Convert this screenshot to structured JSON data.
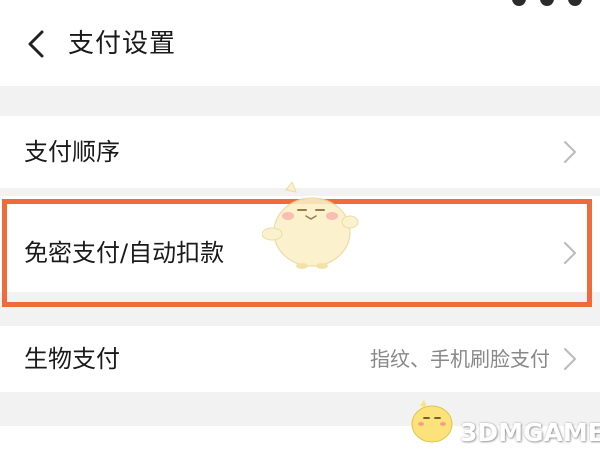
{
  "header": {
    "back_icon": "chevron-left-icon",
    "title": "支付设置"
  },
  "rows": [
    {
      "label": "支付顺序",
      "value": ""
    },
    {
      "label": "免密支付/自动扣款",
      "value": ""
    },
    {
      "label": "生物支付",
      "value": "指纹、手机刷脸支付"
    }
  ],
  "chevron_icon": "chevron-right-icon",
  "highlight_color": "#ee6b3c",
  "watermark": {
    "text": "3DMGAME"
  }
}
